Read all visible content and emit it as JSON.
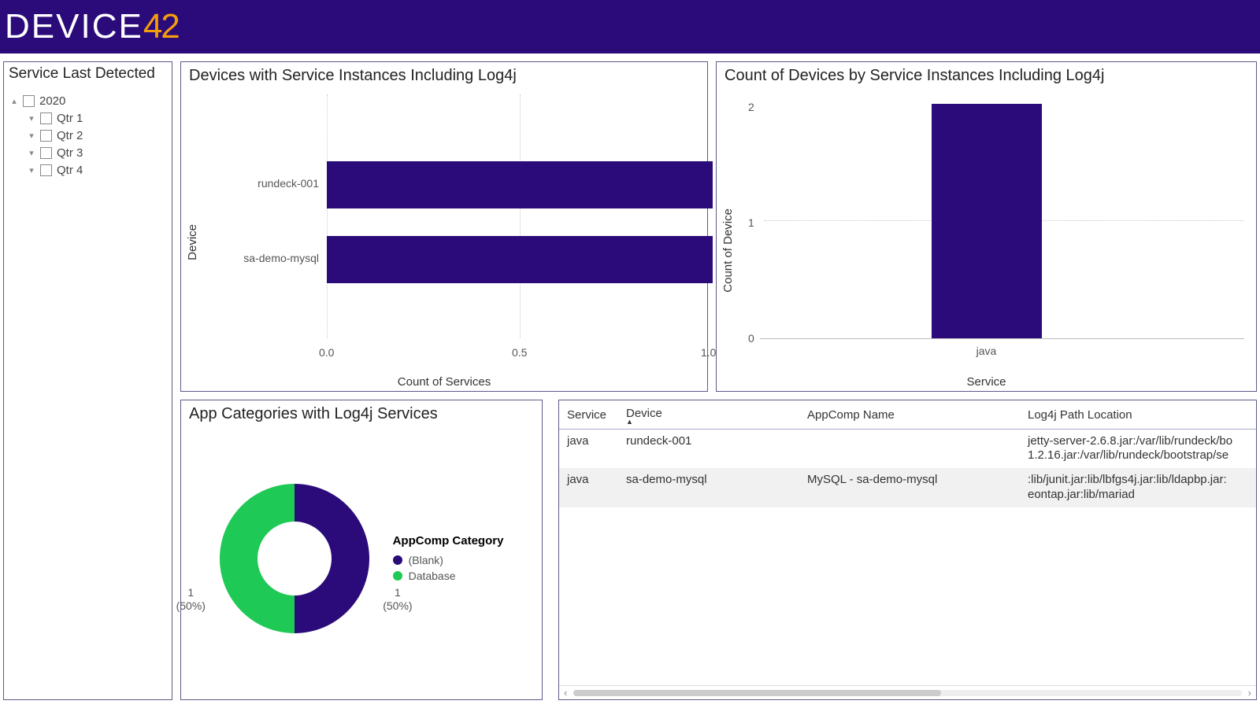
{
  "brand": {
    "text": "DEVICE",
    "accent": "42"
  },
  "sidebar": {
    "title": "Service Last Detected",
    "root": "2020",
    "items": [
      "Qtr 1",
      "Qtr 2",
      "Qtr 3",
      "Qtr 4"
    ]
  },
  "hbar": {
    "title": "Devices with Service Instances Including Log4j",
    "ylabel": "Device",
    "xlabel": "Count of Services",
    "ticks": [
      "0.0",
      "0.5",
      "1.0"
    ]
  },
  "vbar": {
    "title": "Count of Devices by Service Instances Including Log4j",
    "ylabel": "Count of Device",
    "xlabel": "Service",
    "yticks": [
      "0",
      "1",
      "2"
    ],
    "category": "java"
  },
  "donut": {
    "title": "App Categories with Log4j Services",
    "legend_title": "AppComp Category",
    "items": [
      "(Blank)",
      "Database"
    ],
    "labels": {
      "left_n": "1",
      "left_p": "(50%)",
      "right_n": "1",
      "right_p": "(50%)"
    }
  },
  "table": {
    "headers": [
      "Service",
      "Device",
      "AppComp Name",
      "Log4j Path Location"
    ],
    "rows": [
      {
        "service": "java",
        "device": "rundeck-001",
        "appcomp": "",
        "path": "jetty-server-2.6.8.jar:/var/lib/rundeck/bo 1.2.16.jar:/var/lib/rundeck/bootstrap/se"
      },
      {
        "service": "java",
        "device": "sa-demo-mysql",
        "appcomp": "MySQL - sa-demo-mysql",
        "path": ":lib/junit.jar:lib/lbfgs4j.jar:lib/ldapbp.jar: eontap.jar:lib/mariad"
      }
    ]
  },
  "chart_data": [
    {
      "type": "bar",
      "orientation": "horizontal",
      "title": "Devices with Service Instances Including Log4j",
      "xlabel": "Count of Services",
      "ylabel": "Device",
      "categories": [
        "rundeck-001",
        "sa-demo-mysql"
      ],
      "values": [
        1.0,
        1.0
      ],
      "xlim": [
        0,
        1
      ]
    },
    {
      "type": "bar",
      "orientation": "vertical",
      "title": "Count of Devices by Service Instances Including Log4j",
      "xlabel": "Service",
      "ylabel": "Count of Device",
      "categories": [
        "java"
      ],
      "values": [
        2
      ],
      "ylim": [
        0,
        2
      ]
    },
    {
      "type": "pie",
      "title": "App Categories with Log4j Services",
      "series": [
        {
          "name": "(Blank)",
          "value": 1,
          "percent": 50,
          "color": "#2b0a7a"
        },
        {
          "name": "Database",
          "value": 1,
          "percent": 50,
          "color": "#1fc955"
        }
      ]
    },
    {
      "type": "table",
      "columns": [
        "Service",
        "Device",
        "AppComp Name",
        "Log4j Path Location"
      ],
      "rows": [
        [
          "java",
          "rundeck-001",
          "",
          "jetty-server-2.6.8.jar:/var/lib/rundeck/bo 1.2.16.jar:/var/lib/rundeck/bootstrap/se"
        ],
        [
          "java",
          "sa-demo-mysql",
          "MySQL - sa-demo-mysql",
          ":lib/junit.jar:lib/lbfgs4j.jar:lib/ldapbp.jar: eontap.jar:lib/mariad"
        ]
      ]
    }
  ]
}
